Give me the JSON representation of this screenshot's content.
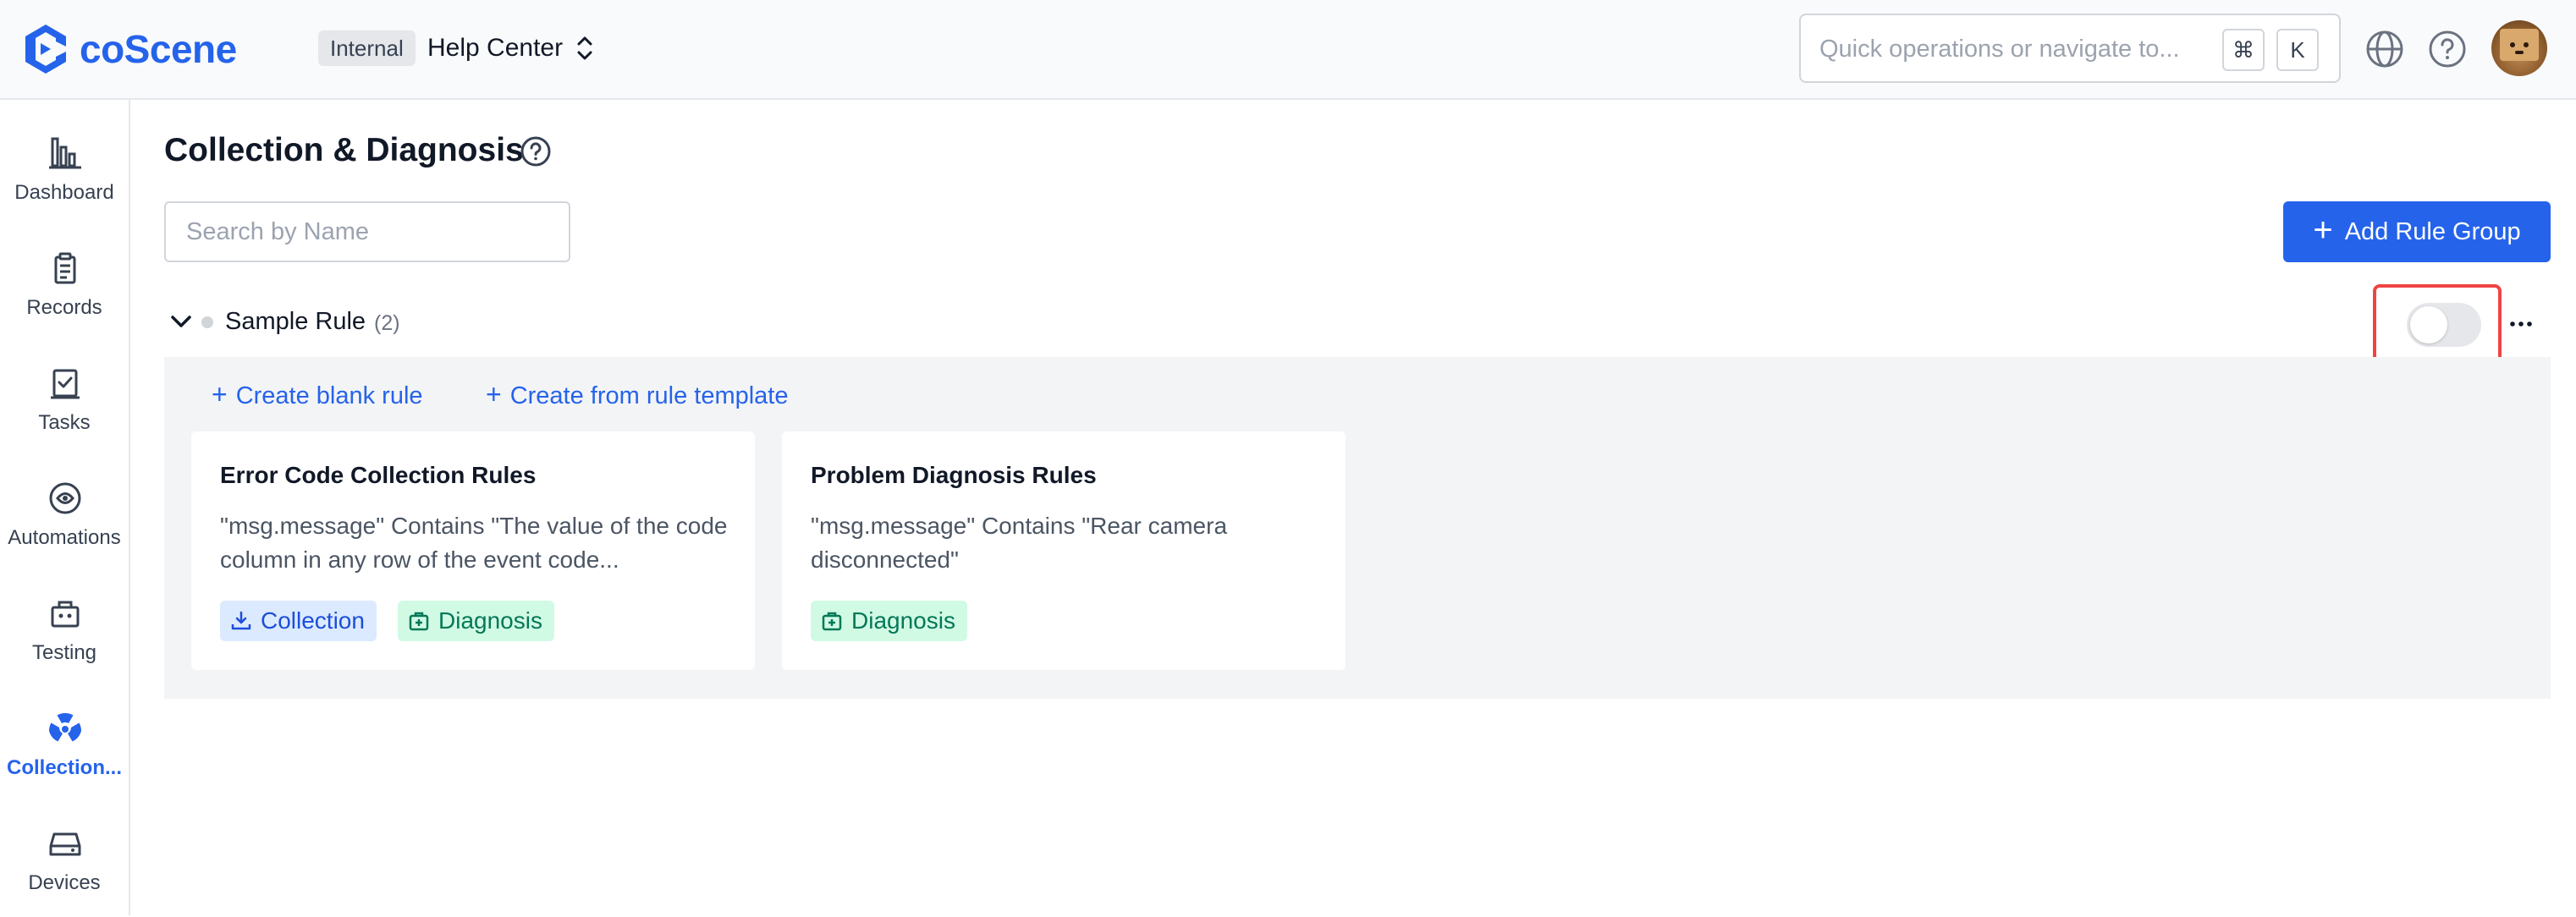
{
  "app": {
    "brand": "coScene",
    "brand_color": "#2563eb",
    "org_badge": "Internal",
    "project_name": "Help Center"
  },
  "header": {
    "search_placeholder": "Quick operations or navigate to...",
    "shortcut_keys": [
      "⌘",
      "K"
    ],
    "icons": [
      "globe-icon",
      "help-icon",
      "avatar"
    ]
  },
  "sidebar": {
    "items": [
      {
        "label": "Dashboard",
        "icon": "bar-chart-icon",
        "active": false
      },
      {
        "label": "Records",
        "icon": "clipboard-icon",
        "active": false
      },
      {
        "label": "Tasks",
        "icon": "task-check-icon",
        "active": false
      },
      {
        "label": "Automations",
        "icon": "automation-icon",
        "active": false
      },
      {
        "label": "Testing",
        "icon": "testing-icon",
        "active": false
      },
      {
        "label": "Collection...",
        "icon": "radiation-icon",
        "active": true
      },
      {
        "label": "Devices",
        "icon": "device-icon",
        "active": false
      }
    ]
  },
  "main": {
    "title": "Collection & Diagnosis",
    "search_placeholder": "Search by Name",
    "add_button_label": "Add Rule Group",
    "rule_group": {
      "name": "Sample Rule",
      "count": "(2)",
      "enabled": false,
      "create_blank_label": "Create blank rule",
      "create_template_label": "Create from rule template",
      "rules": [
        {
          "title": "Error Code Collection Rules",
          "description": "\"msg.message\" Contains \"The value of the code column in any row of the event code...",
          "tags": [
            {
              "label": "Collection",
              "type": "collection"
            },
            {
              "label": "Diagnosis",
              "type": "diagnosis"
            }
          ]
        },
        {
          "title": "Problem Diagnosis Rules",
          "description": "\"msg.message\" Contains \"Rear camera disconnected\"",
          "tags": [
            {
              "label": "Diagnosis",
              "type": "diagnosis"
            }
          ]
        }
      ]
    }
  },
  "colors": {
    "primary": "#2563eb",
    "collection_tag_bg": "#dbeafe",
    "diagnosis_tag_bg": "#d1fae5",
    "highlight": "#ef4444"
  }
}
